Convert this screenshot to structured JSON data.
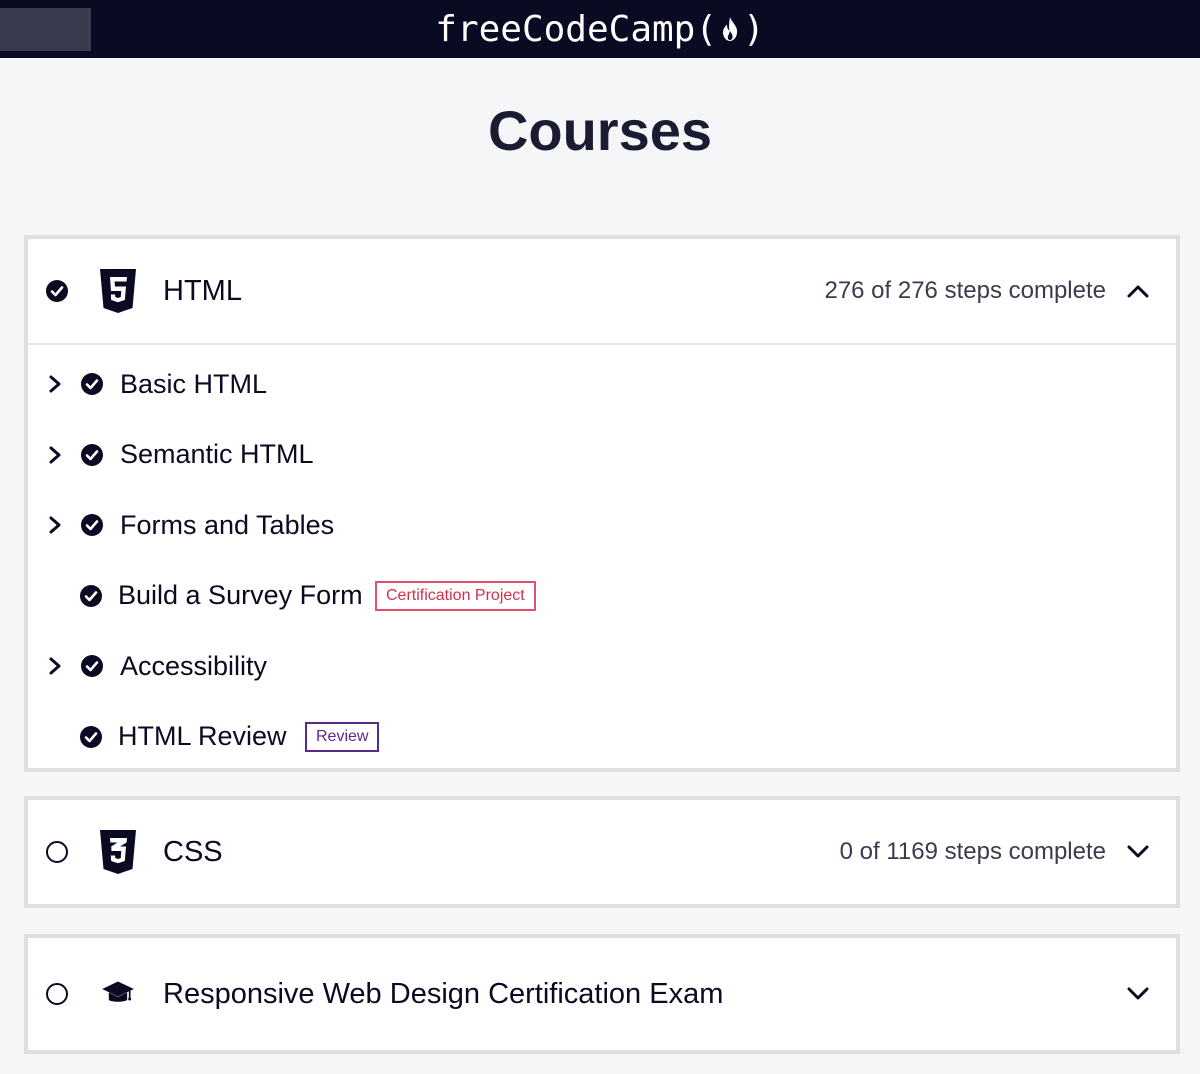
{
  "navbar": {
    "brand": "freeCodeCamp",
    "brand_open": "(",
    "brand_close": ")",
    "brand_icon": "flame-icon"
  },
  "page": {
    "title": "Courses"
  },
  "blocks": [
    {
      "title": "HTML",
      "icon": "html5-icon",
      "completed": true,
      "expanded": true,
      "progress": "276 of 276 steps complete",
      "items": [
        {
          "label": "Basic HTML",
          "expandable": true,
          "completed": true
        },
        {
          "label": "Semantic HTML",
          "expandable": true,
          "completed": true
        },
        {
          "label": "Forms and Tables",
          "expandable": true,
          "completed": true
        },
        {
          "label": "Build a Survey Form",
          "expandable": false,
          "completed": true,
          "tag": "Certification Project"
        },
        {
          "label": "Accessibility",
          "expandable": true,
          "completed": true
        },
        {
          "label": "HTML Review",
          "expandable": false,
          "completed": true,
          "tag": "Review"
        }
      ]
    },
    {
      "title": "CSS",
      "icon": "css3-icon",
      "completed": false,
      "expanded": false,
      "progress": "0 of 1169 steps complete"
    },
    {
      "title": "Responsive Web Design Certification Exam",
      "icon": "graduation-cap-icon",
      "completed": false,
      "expanded": false,
      "progress": ""
    }
  ],
  "colors": {
    "navbar_bg": "#0a0a23",
    "page_bg": "#f5f6f7",
    "cert_tag": "#d0314f",
    "review_tag": "#5a2a8a"
  }
}
